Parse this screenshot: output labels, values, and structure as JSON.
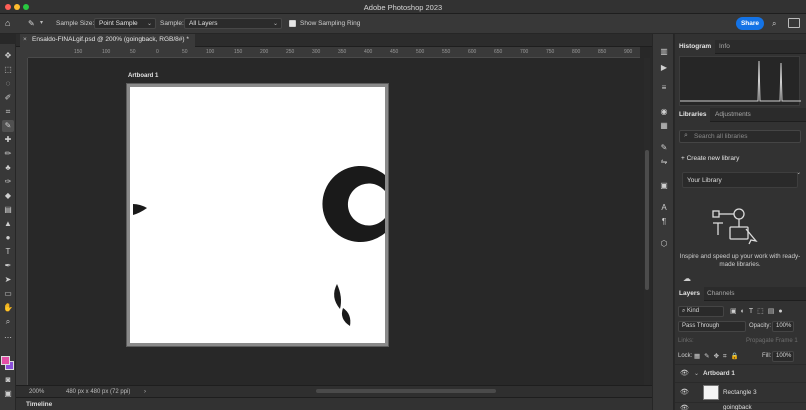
{
  "app": {
    "title": "Adobe Photoshop 2023"
  },
  "options_bar": {
    "sample_size_label": "Sample Size:",
    "sample_size_value": "Point Sample",
    "sample_label": "Sample:",
    "sample_value": "All Layers",
    "show_sampling_ring": "Show Sampling Ring",
    "share": "Share"
  },
  "document": {
    "tab_title": "Ensaldo-FINALgif.psd @ 200% (goingback, RGB/8#) *",
    "artboard_label": "Artboard 1"
  },
  "rulers": {
    "horizontal": [
      "150",
      "100",
      "50",
      "0",
      "50",
      "100",
      "150",
      "200",
      "250",
      "300",
      "350",
      "400",
      "450",
      "500",
      "550",
      "600",
      "650",
      "700",
      "750",
      "800",
      "850",
      "900"
    ]
  },
  "status": {
    "zoom": "200%",
    "doc_info": "480 px x 480 px (72 ppi)"
  },
  "timeline": {
    "label": "Timeline"
  },
  "panels": {
    "histogram_tabs": [
      "Histogram",
      "Info"
    ],
    "libraries_tabs": [
      "Libraries",
      "Adjustments"
    ],
    "search_placeholder": "Search all libraries",
    "create_new_library": "Create new library",
    "your_library": "Your Library",
    "inspire_text": "Inspire and speed up your work with ready-made libraries.",
    "layers_tabs": [
      "Layers",
      "Channels"
    ],
    "kind_filter": "Kind",
    "blend_mode": "Pass Through",
    "opacity_label": "Opacity:",
    "opacity_value": "100%",
    "lock_label": "Lock:",
    "fill_label": "Fill:",
    "fill_value": "100%",
    "links_label": "Links:",
    "propagate_label": "Propagate Frame 1",
    "layers": [
      "Artboard 1",
      "Rectangle 3",
      "goingback"
    ]
  },
  "colors": {
    "accent": "#1473e6",
    "foreground_swatch": "#e24fa6",
    "background_swatch": "#8a4fd8"
  }
}
